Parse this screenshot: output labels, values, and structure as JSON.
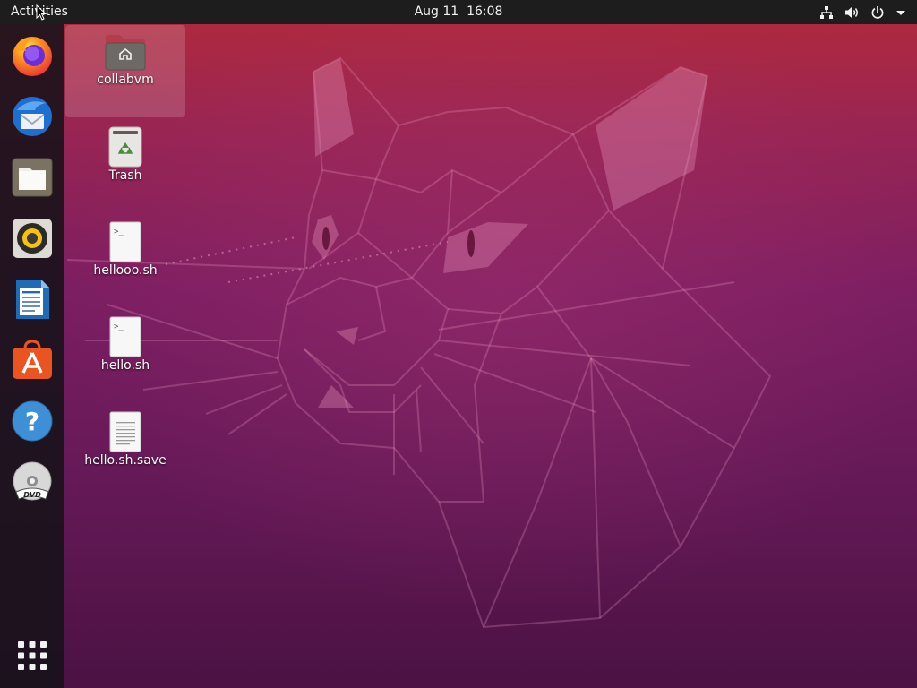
{
  "topbar": {
    "activities": "Activities",
    "clock": "Aug 11  16:08"
  },
  "tray": {
    "icons": [
      "network-icon",
      "volume-icon",
      "power-icon",
      "chevron-down-icon"
    ]
  },
  "dock": {
    "items": [
      "firefox-icon",
      "thunderbird-icon",
      "files-icon",
      "rhythmbox-icon",
      "libreoffice-writer-icon",
      "software-center-icon",
      "help-icon",
      "dvd-icon"
    ],
    "dvd_label": "DVD",
    "show_apps": "show-applications-icon"
  },
  "desktop": {
    "icons": [
      {
        "label": "collabvm",
        "kind": "home-folder"
      },
      {
        "label": "Trash",
        "kind": "trash"
      },
      {
        "label": "hellooo.sh",
        "kind": "script"
      },
      {
        "label": "hello.sh",
        "kind": "script"
      },
      {
        "label": "hello.sh.save",
        "kind": "text-file"
      }
    ]
  },
  "colors": {
    "topbar": "#1d1d1d",
    "dock": "#161218",
    "wallpaper_top": "#b32a3b",
    "wallpaper_bottom": "#4b1243",
    "accent": "#e95420"
  }
}
